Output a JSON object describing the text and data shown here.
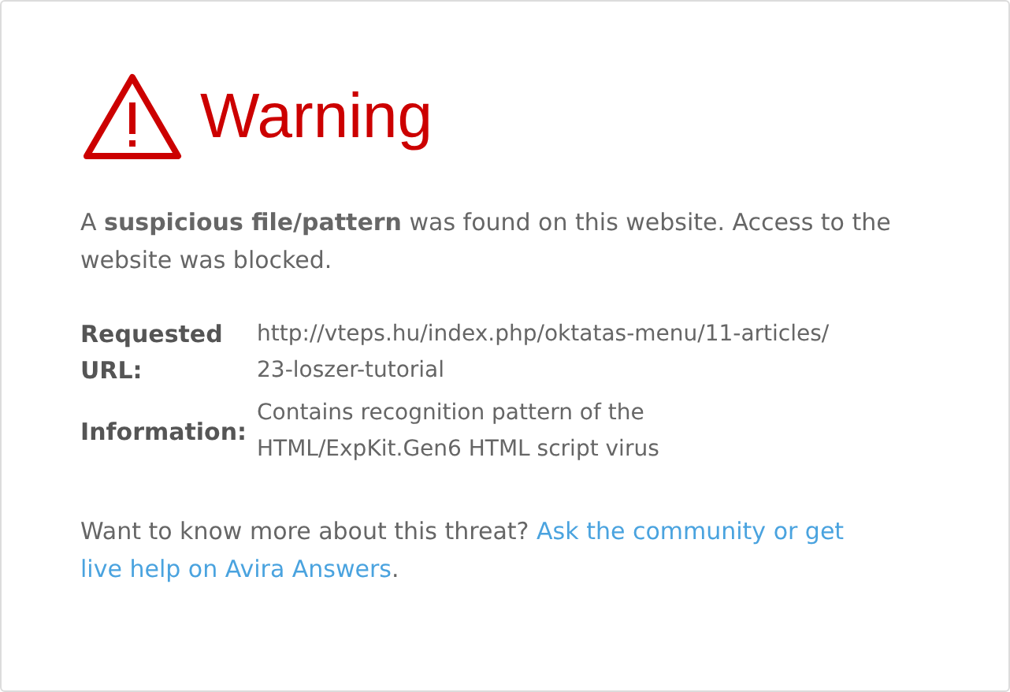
{
  "title": "Warning",
  "message": "A **suspicious file/pattern** was found on this website. Access to the website was blocked.",
  "details": [
    {
      "label": "Requested URL:",
      "value": [
        "http://vteps.hu/index.php/oktatas-menu/11-articles/",
        "23-loszer-tutorial"
      ]
    },
    {
      "label": "Information:",
      "value": [
        "Contains recognition pattern of the",
        "HTML/ExpKit.Gen6 HTML script virus"
      ]
    }
  ],
  "footer": {
    "text": "Want to know more about this threat?",
    "link": [
      "Ask the community or get",
      "live help on Avira Answers"
    ],
    "end": "."
  }
}
